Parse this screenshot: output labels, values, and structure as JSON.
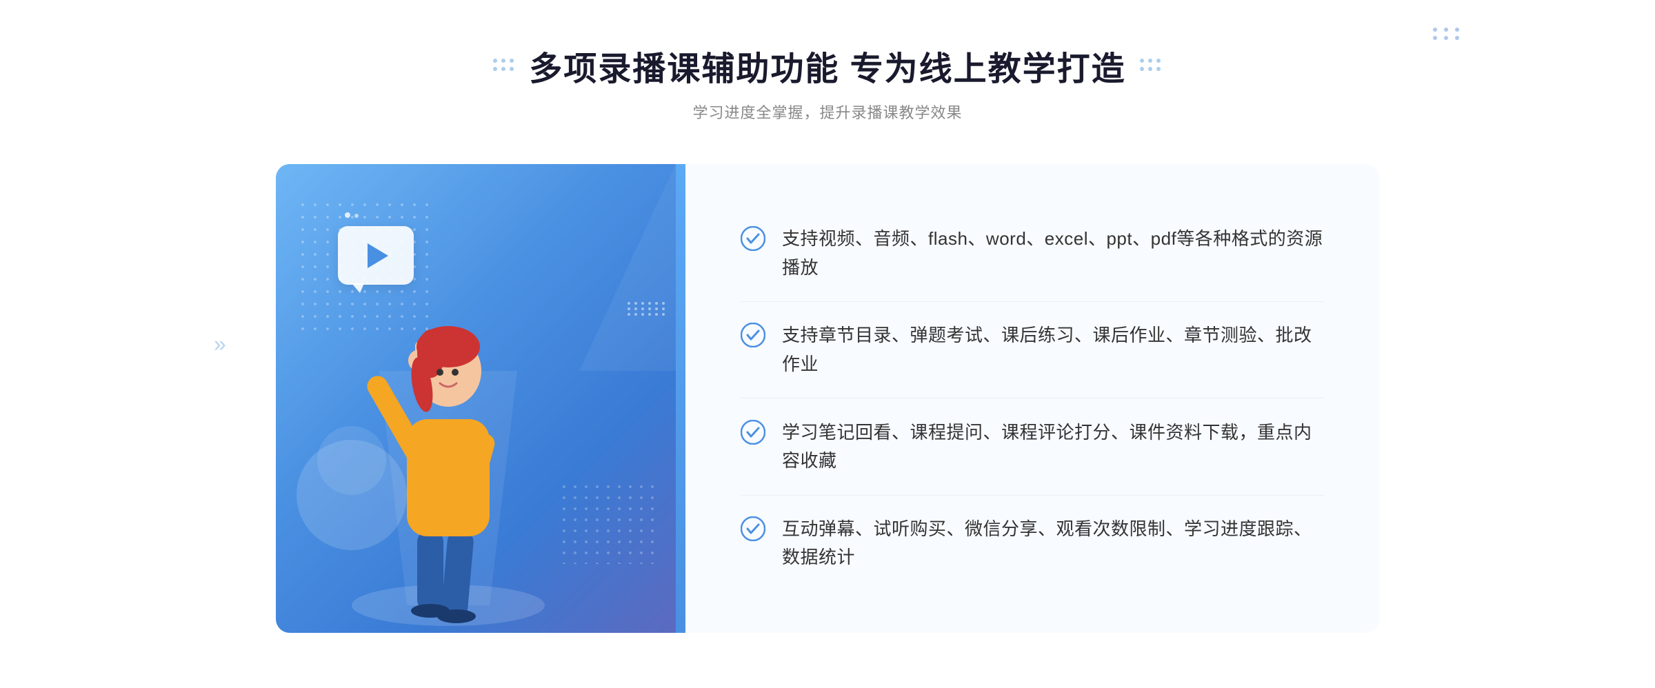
{
  "header": {
    "title": "多项录播课辅助功能 专为线上教学打造",
    "subtitle": "学习进度全掌握，提升录播课教学效果",
    "left_decorator_label": "dots-left",
    "right_decorator_label": "dots-right"
  },
  "features": [
    {
      "id": 1,
      "text": "支持视频、音频、flash、word、excel、ppt、pdf等各种格式的资源播放"
    },
    {
      "id": 2,
      "text": "支持章节目录、弹题考试、课后练习、课后作业、章节测验、批改作业"
    },
    {
      "id": 3,
      "text": "学习笔记回看、课程提问、课程评论打分、课件资料下载，重点内容收藏"
    },
    {
      "id": 4,
      "text": "互动弹幕、试听购买、微信分享、观看次数限制、学习进度跟踪、数据统计"
    }
  ],
  "colors": {
    "primary_blue": "#4a90e2",
    "light_blue": "#6eb6f5",
    "bg_white": "#ffffff",
    "bg_light": "#f8fbff",
    "text_dark": "#1a1a2e",
    "text_gray": "#888888",
    "text_normal": "#333333",
    "check_green": "#4a90e2",
    "divider": "#e8f0fa"
  },
  "icons": {
    "play": "▶",
    "chevrons": "»",
    "check_circle": "check-circle"
  }
}
